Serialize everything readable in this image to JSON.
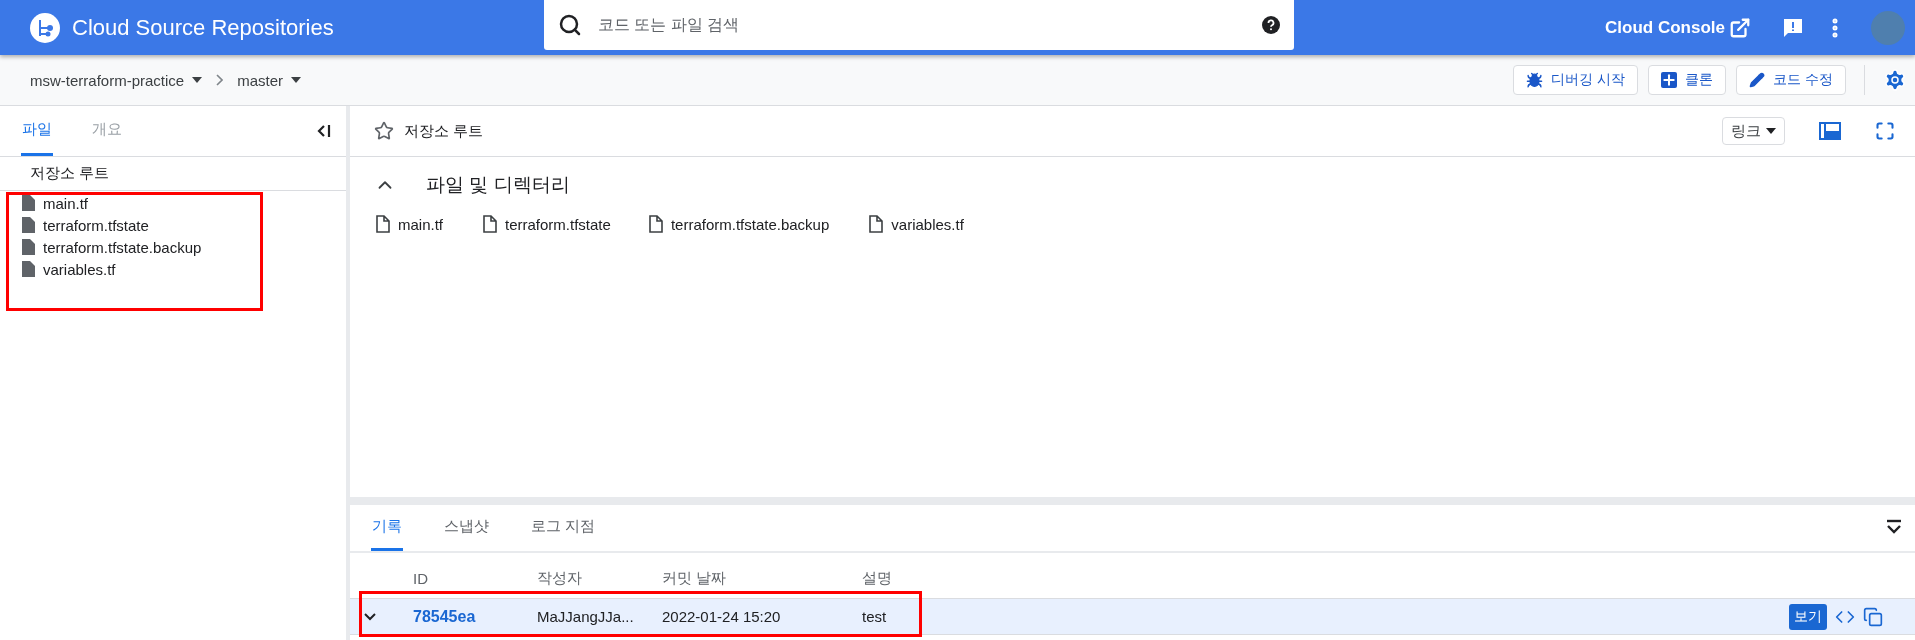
{
  "app": {
    "title": "Cloud Source Repositories"
  },
  "search": {
    "placeholder": "코드 또는 파일 검색"
  },
  "console_link": "Cloud Console",
  "breadcrumb": {
    "repository": "msw-terraform-practice",
    "branch": "master"
  },
  "actions": [
    {
      "label": "디버깅 시작",
      "kind": "debug"
    },
    {
      "label": "클론",
      "kind": "clone"
    },
    {
      "label": "코드 수정",
      "kind": "edit"
    }
  ],
  "sidebar": {
    "tabs": [
      {
        "label": "파일",
        "selected": true
      },
      {
        "label": "개요",
        "selected": false
      }
    ],
    "root": "저장소 루트",
    "files": [
      "main.tf",
      "terraform.tfstate",
      "terraform.tfstate.backup",
      "variables.tf"
    ]
  },
  "content": {
    "path": "저장소 루트",
    "starred": false,
    "link_menu": "링크",
    "section": {
      "title": "파일 및 디렉터리",
      "expanded": true,
      "files": [
        "main.tf",
        "terraform.tfstate",
        "terraform.tfstate.backup",
        "variables.tf"
      ]
    }
  },
  "history": {
    "tabs": [
      {
        "label": "기록",
        "selected": true
      },
      {
        "label": "스냅샷",
        "selected": false
      },
      {
        "label": "로그 지점",
        "selected": false
      }
    ],
    "columns": [
      "ID",
      "작성자",
      "커밋 날짜",
      "설명"
    ],
    "rows": [
      {
        "id": "78545ea",
        "author": "MaJJangJJa...",
        "date": "2022-01-24 15:20",
        "description": "test",
        "selected": true,
        "expanded": false,
        "view_button": "보기"
      }
    ]
  }
}
